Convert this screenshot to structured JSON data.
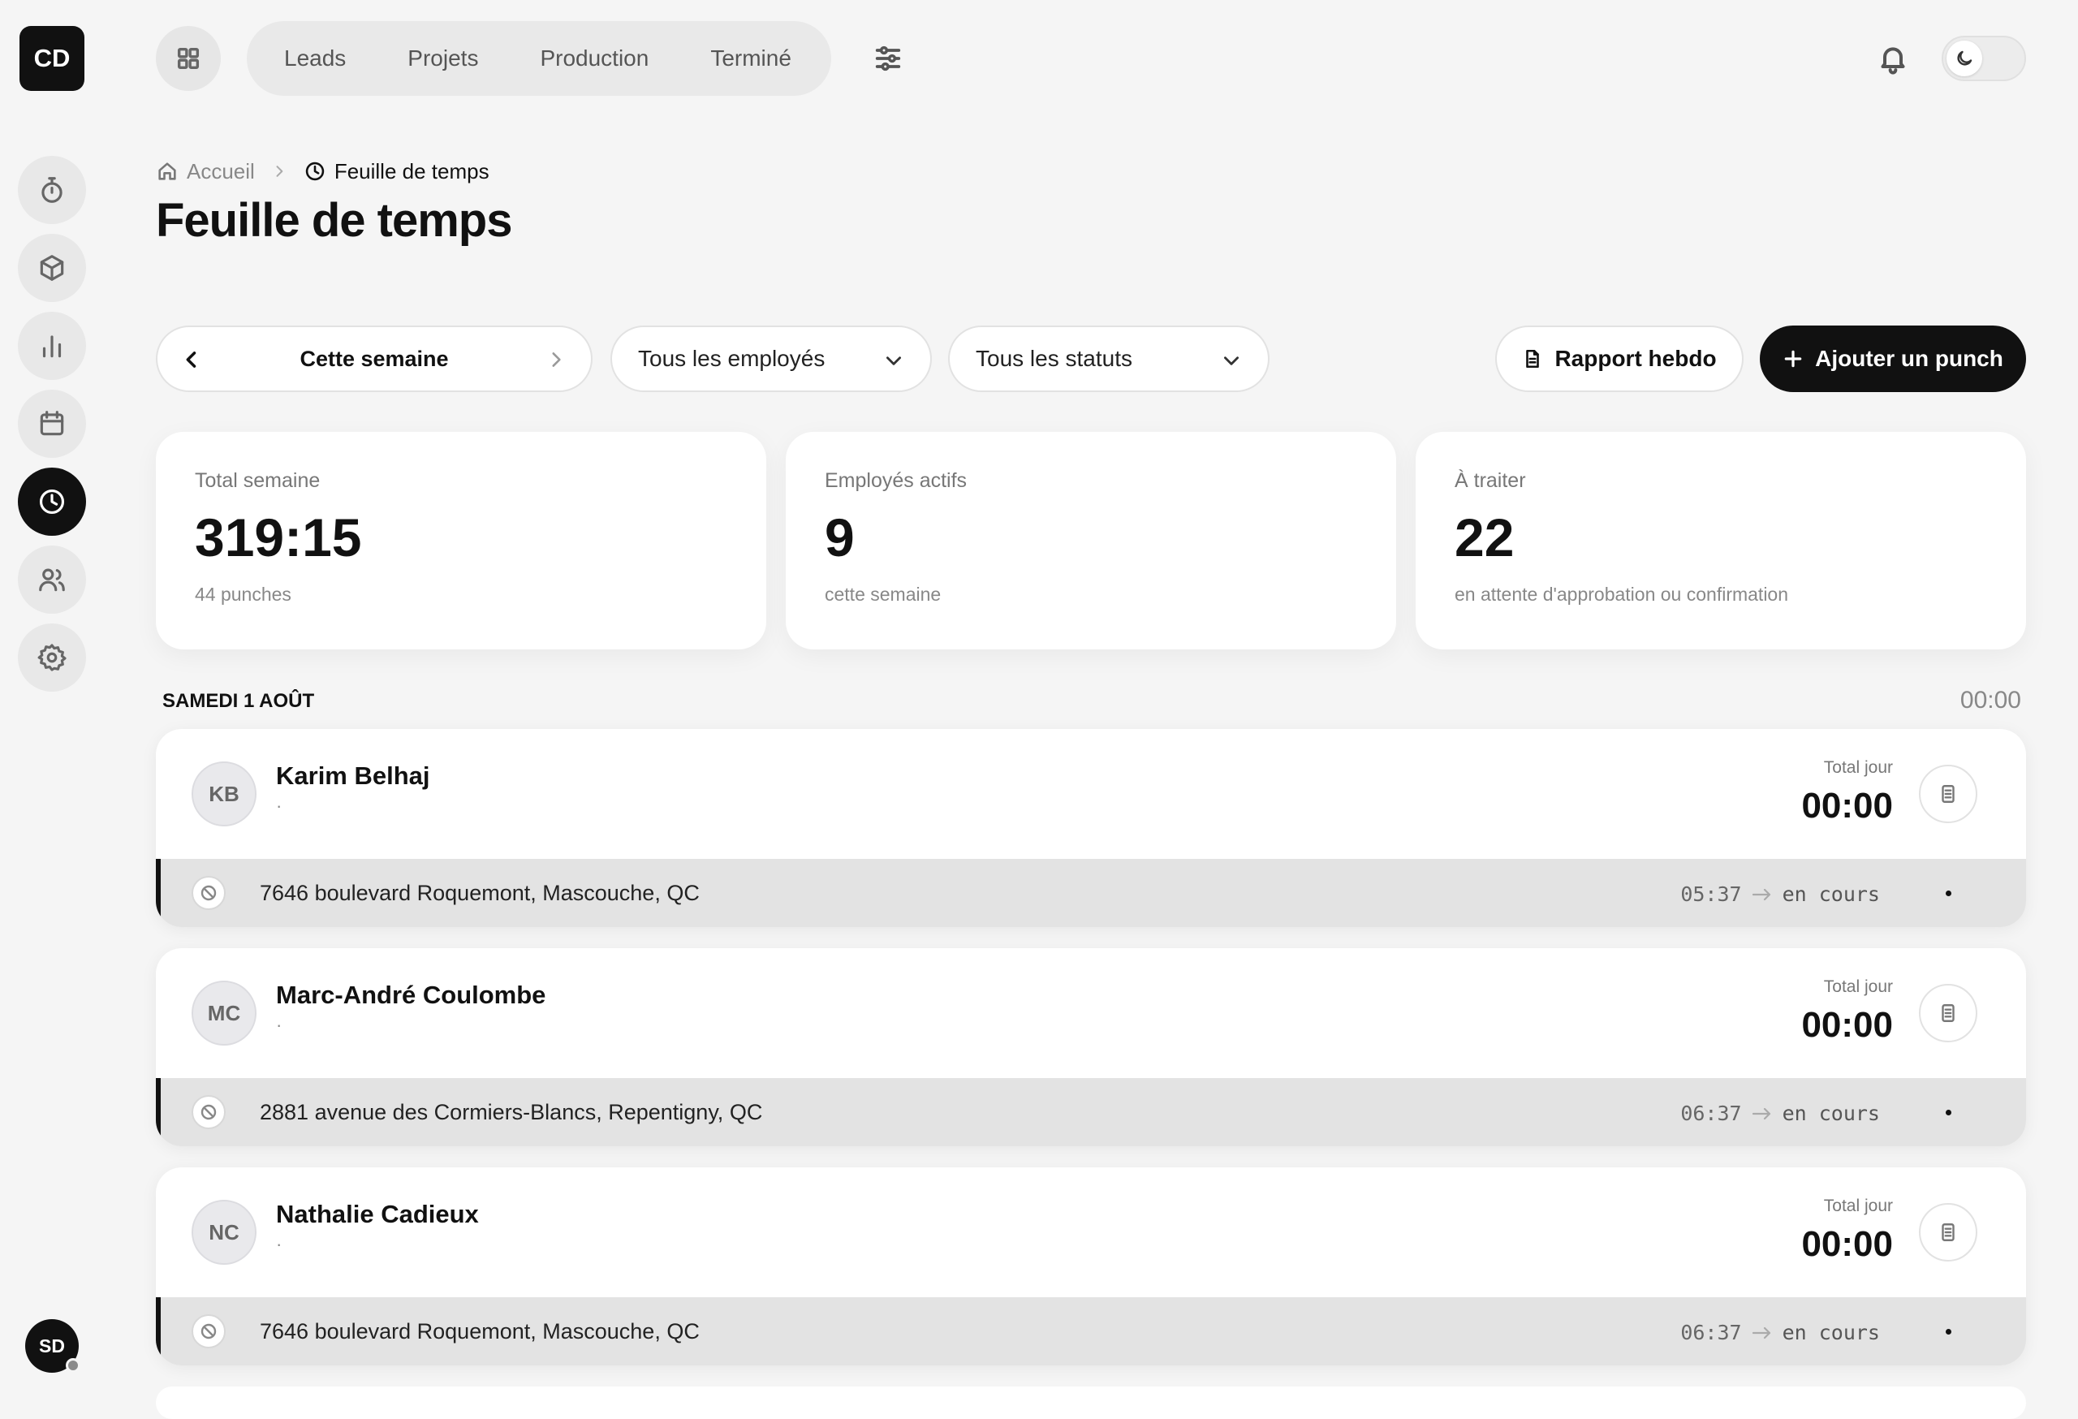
{
  "rail": {
    "logo": "CD",
    "user_initials": "SD",
    "items": [
      {
        "name": "timer",
        "icon": "stopwatch-icon"
      },
      {
        "name": "products",
        "icon": "cube-icon"
      },
      {
        "name": "reports",
        "icon": "bar-chart-icon"
      },
      {
        "name": "calendar",
        "icon": "calendar-icon"
      },
      {
        "name": "timesheet",
        "icon": "clock-icon",
        "active": true
      },
      {
        "name": "team",
        "icon": "users-icon"
      },
      {
        "name": "settings",
        "icon": "gear-icon"
      }
    ]
  },
  "topnav": {
    "items": [
      "Leads",
      "Projets",
      "Production",
      "Terminé"
    ]
  },
  "breadcrumb": {
    "home": "Accueil",
    "current": "Feuille de temps"
  },
  "page": {
    "title": "Feuille de temps"
  },
  "controls": {
    "week_label": "Cette semaine",
    "employees_select": "Tous les employés",
    "status_select": "Tous les statuts",
    "report_button": "Rapport hebdo",
    "add_button": "Ajouter un punch"
  },
  "stats": [
    {
      "label": "Total semaine",
      "value": "319:15",
      "sub": "44 punches"
    },
    {
      "label": "Employés actifs",
      "value": "9",
      "sub": "cette semaine"
    },
    {
      "label": "À traiter",
      "value": "22",
      "sub": "en attente d'approbation ou confirmation"
    }
  ],
  "day": {
    "label": "SAMEDI 1 AOÛT",
    "total": "00:00",
    "entries": [
      {
        "initials": "KB",
        "name": "Karim Belhaj",
        "meta": "·",
        "total_label": "Total jour",
        "total": "00:00",
        "punch": {
          "address": "7646 boulevard Roquemont, Mascouche, QC",
          "start": "05:37",
          "state": "en cours"
        }
      },
      {
        "initials": "MC",
        "name": "Marc-André Coulombe",
        "meta": "·",
        "total_label": "Total jour",
        "total": "00:00",
        "punch": {
          "address": "2881 avenue des Cormiers-Blancs, Repentigny, QC",
          "start": "06:37",
          "state": "en cours"
        }
      },
      {
        "initials": "NC",
        "name": "Nathalie Cadieux",
        "meta": "·",
        "total_label": "Total jour",
        "total": "00:00",
        "punch": {
          "address": "7646 boulevard Roquemont, Mascouche, QC",
          "start": "06:37",
          "state": "en cours"
        }
      }
    ]
  },
  "colors": {
    "background": "#f5f5f5",
    "accent": "#111111",
    "card": "#ffffff",
    "punch_row": "#e3e3e3"
  }
}
